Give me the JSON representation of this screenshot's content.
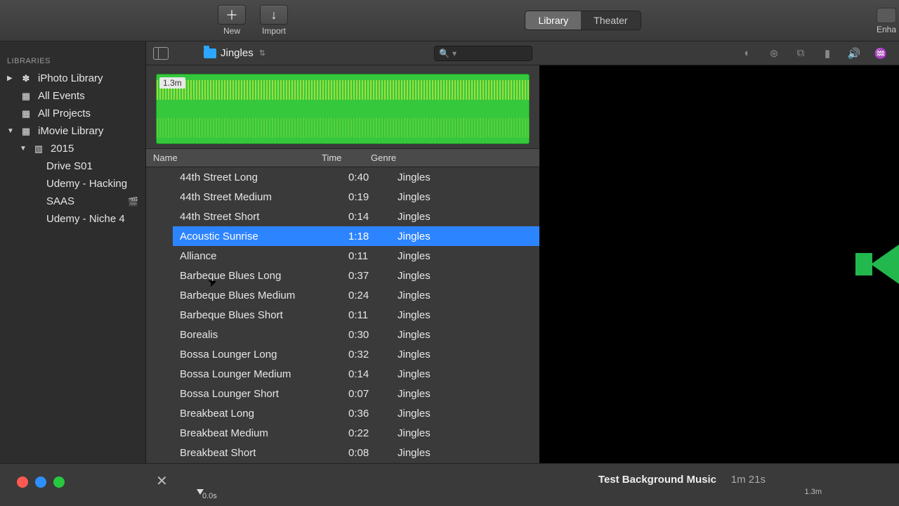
{
  "toolbar": {
    "new_label": "New",
    "import_label": "Import",
    "enhance_label": "Enha"
  },
  "view_switch": {
    "library": "Library",
    "theater": "Theater",
    "active": "library"
  },
  "sidebar": {
    "header": "LIBRARIES",
    "iphoto": "iPhoto Library",
    "all_events": "All Events",
    "all_projects": "All Projects",
    "imovie": "iMovie Library",
    "year": "2015",
    "projects": [
      "Drive S01",
      "Udemy - Hacking",
      "SAAS",
      "Udemy - Niche 4"
    ]
  },
  "breadcrumb": {
    "folder": "Jingles",
    "waveform_label": "1.3m"
  },
  "columns": {
    "name": "Name",
    "time": "Time",
    "genre": "Genre"
  },
  "tracks": [
    {
      "name": "44th Street Long",
      "time": "0:40",
      "genre": "Jingles"
    },
    {
      "name": "44th Street Medium",
      "time": "0:19",
      "genre": "Jingles"
    },
    {
      "name": "44th Street Short",
      "time": "0:14",
      "genre": "Jingles"
    },
    {
      "name": "Acoustic Sunrise",
      "time": "1:18",
      "genre": "Jingles",
      "selected": true
    },
    {
      "name": "Alliance",
      "time": "0:11",
      "genre": "Jingles"
    },
    {
      "name": "Barbeque Blues Long",
      "time": "0:37",
      "genre": "Jingles"
    },
    {
      "name": "Barbeque Blues Medium",
      "time": "0:24",
      "genre": "Jingles"
    },
    {
      "name": "Barbeque Blues Short",
      "time": "0:11",
      "genre": "Jingles"
    },
    {
      "name": "Borealis",
      "time": "0:30",
      "genre": "Jingles"
    },
    {
      "name": "Bossa Lounger Long",
      "time": "0:32",
      "genre": "Jingles"
    },
    {
      "name": "Bossa Lounger Medium",
      "time": "0:14",
      "genre": "Jingles"
    },
    {
      "name": "Bossa Lounger Short",
      "time": "0:07",
      "genre": "Jingles"
    },
    {
      "name": "Breakbeat Long",
      "time": "0:36",
      "genre": "Jingles"
    },
    {
      "name": "Breakbeat Medium",
      "time": "0:22",
      "genre": "Jingles"
    },
    {
      "name": "Breakbeat Short",
      "time": "0:08",
      "genre": "Jingles"
    }
  ],
  "timeline": {
    "project_title": "Test Background Music",
    "project_duration": "1m 21s",
    "scale_label": "1.3m",
    "zero_label": "0.0s"
  }
}
